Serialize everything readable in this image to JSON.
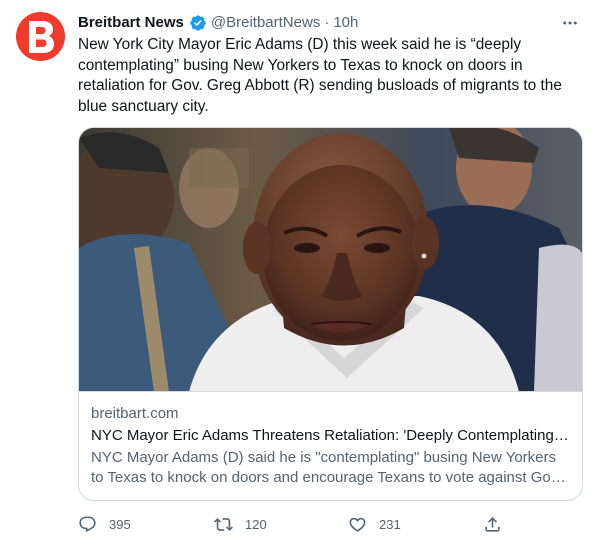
{
  "author": {
    "display_name": "Breitbart News",
    "handle": "@BreitbartNews",
    "separator": "·",
    "timestamp": "10h",
    "avatar_icon": "breitbart-b-logo",
    "avatar_color": "#ee3b2d",
    "verified": true
  },
  "tweet": {
    "text": "New York City Mayor Eric Adams (D) this week said he is “deeply contemplating” busing New Yorkers to Texas to knock on doors in retaliation for Gov. Greg Abbott (R) sending busloads of migrants to the blue sanctuary city."
  },
  "card": {
    "domain": "breitbart.com",
    "title": "NYC Mayor Eric Adams Threatens Retaliation: 'Deeply Contemplating' Busing New Yorkers to Texas",
    "description": "NYC Mayor Adams (D) said he is \"contemplating\" busing New Yorkers to Texas to knock on doors and encourage Texans to vote against Gov. Abbott"
  },
  "actions": {
    "reply_count": "395",
    "retweet_count": "120",
    "like_count": "231"
  },
  "colors": {
    "text": "#0f1419",
    "secondary": "#536471",
    "border": "#cfd9de",
    "verified": "#1d9bf0"
  }
}
